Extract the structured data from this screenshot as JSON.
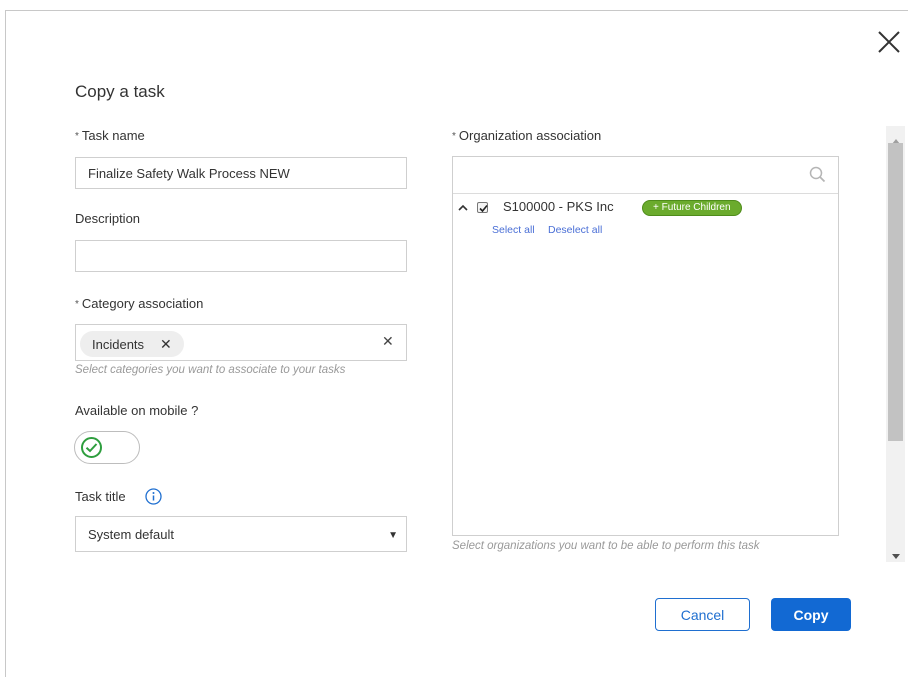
{
  "dialog": {
    "title": "Copy a task"
  },
  "form": {
    "task_name": {
      "required_mark": "*",
      "label": "Task name",
      "value": "Finalize Safety Walk Process NEW"
    },
    "description": {
      "label": "Description",
      "value": ""
    },
    "category": {
      "required_mark": "*",
      "label": "Category association",
      "chip_label": "Incidents",
      "chip_remove": "✕",
      "clear": "✕",
      "hint": "Select categories you want to associate to your tasks"
    },
    "mobile": {
      "label": "Available on mobile ?",
      "enabled": true
    },
    "task_title": {
      "label": "Task title",
      "selected": "System default",
      "caret": "▼"
    }
  },
  "organization": {
    "required_mark": "*",
    "label": "Organization association",
    "search_value": "",
    "item": {
      "name": "S100000 - PKS Inc",
      "checked": true,
      "badge": "+ Future Children"
    },
    "select_all": "Select all",
    "deselect_all": "Deselect all",
    "hint": "Select organizations you want to be able to perform this task"
  },
  "buttons": {
    "cancel": "Cancel",
    "copy": "Copy"
  },
  "colors": {
    "primary": "#1269d3",
    "badge_green": "#6bab2d",
    "toggle_check": "#2e9e3e",
    "info_blue": "#1f6fd0"
  },
  "icons": {
    "close": "close-icon",
    "info": "info-icon",
    "search": "search-icon",
    "toggle": "check-circle-icon",
    "collapse": "chevron-up-icon"
  }
}
